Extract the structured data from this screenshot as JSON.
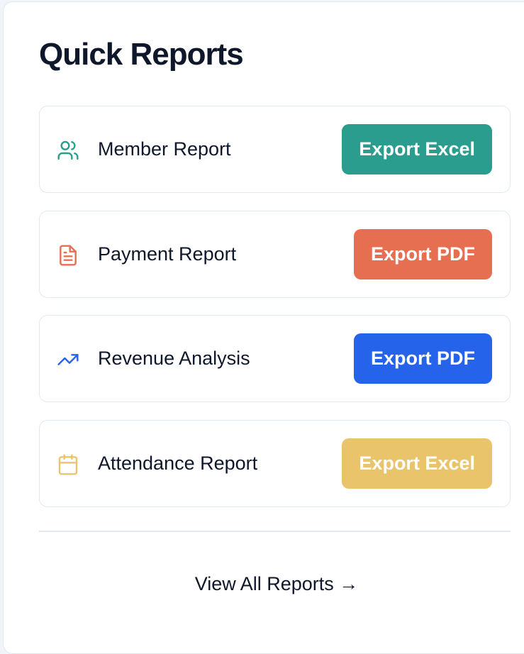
{
  "header": {
    "title": "Quick Reports"
  },
  "reports": [
    {
      "label": "Member Report",
      "icon": "users-icon",
      "icon_color": "#2a9d8f",
      "button_label": "Export Excel",
      "button_color": "#2a9d8f"
    },
    {
      "label": "Payment Report",
      "icon": "file-text-icon",
      "icon_color": "#e76f51",
      "button_label": "Export PDF",
      "button_color": "#e76f51"
    },
    {
      "label": "Revenue Analysis",
      "icon": "trending-up-icon",
      "icon_color": "#2563eb",
      "button_label": "Export PDF",
      "button_color": "#2563eb"
    },
    {
      "label": "Attendance Report",
      "icon": "calendar-icon",
      "icon_color": "#e9c46a",
      "button_label": "Export Excel",
      "button_color": "#e9c46a"
    }
  ],
  "footer": {
    "view_all_label": "View All Reports →"
  }
}
